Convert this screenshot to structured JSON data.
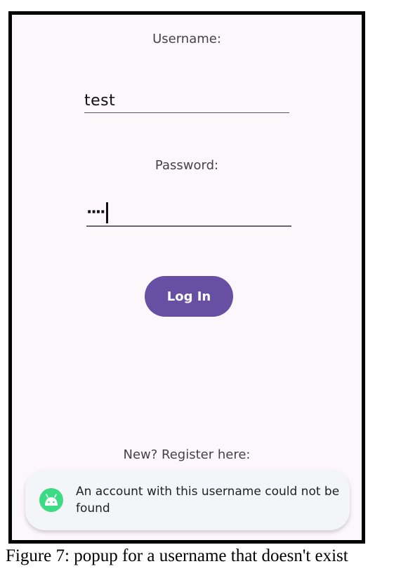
{
  "form": {
    "username_label": "Username:",
    "username_value": "test",
    "password_label": "Password:",
    "password_masked": "····",
    "login_button_label": "Log In",
    "register_label": "New? Register here:"
  },
  "toast": {
    "icon": "android-icon",
    "message": "An account with this username could not be found"
  },
  "caption": "Figure 7: popup for a username that doesn't exist",
  "colors": {
    "accent": "#6750a4",
    "background": "#fcf7fb",
    "toast_icon": "#3ddc84"
  }
}
